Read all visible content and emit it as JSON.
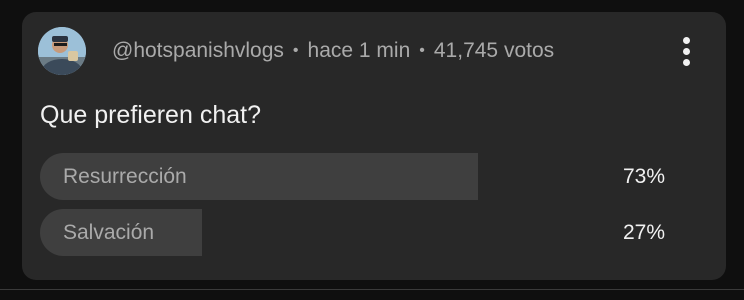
{
  "post": {
    "author": "@hotspanishvlogs",
    "time": "hace 1 min",
    "votes": "41,745 votos",
    "separator": "•",
    "question": "Que prefieren chat?"
  },
  "options": [
    {
      "label": "Resurrección",
      "percent_text": "73%",
      "percent": 73
    },
    {
      "label": "Salvación",
      "percent_text": "27%",
      "percent": 27
    }
  ],
  "colors": {
    "page_bg": "#0f0f0f",
    "card_bg": "#282828",
    "bar_fill": "#3f3f3f",
    "text_primary": "#f1f1f1",
    "text_secondary": "#aaaaaa"
  },
  "icons": {
    "menu": "more-vert-icon",
    "avatar": "channel-avatar"
  }
}
